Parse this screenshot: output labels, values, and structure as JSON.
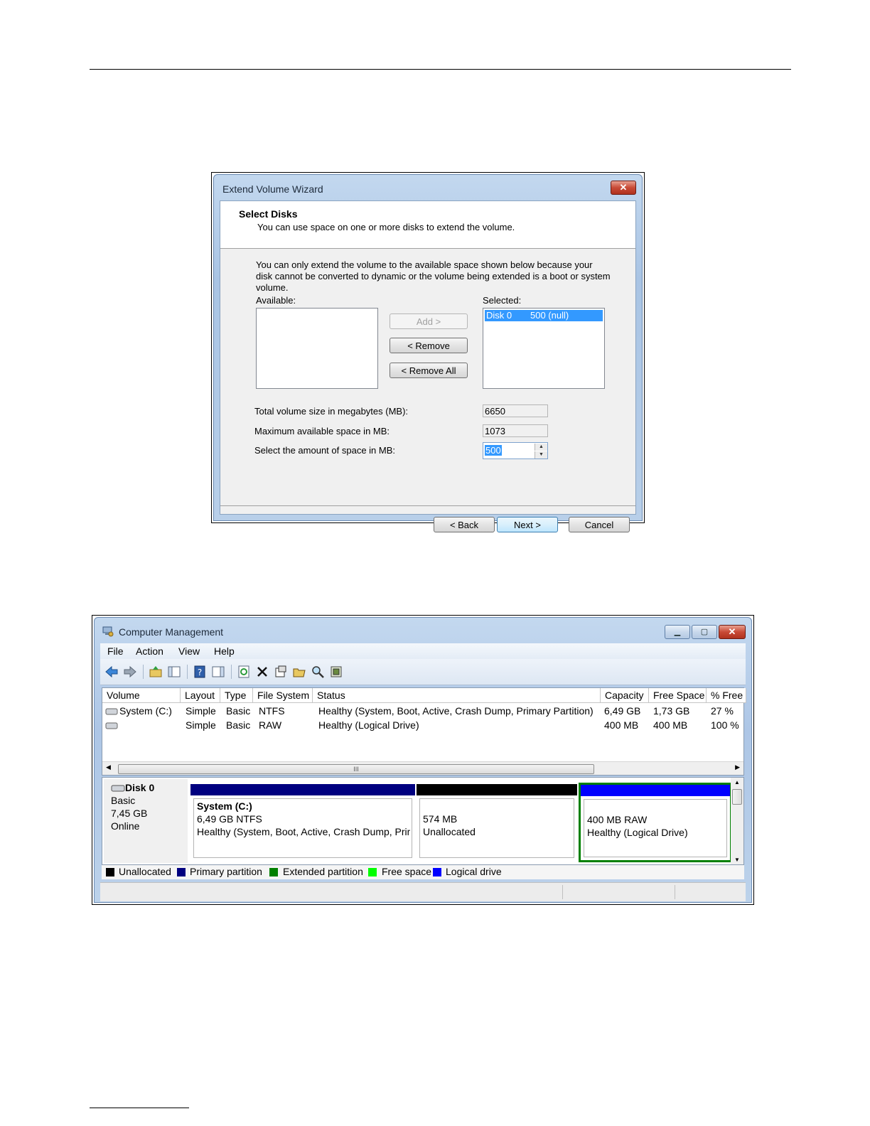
{
  "wizard": {
    "title": "Extend Volume Wizard",
    "close_glyph": "✕",
    "header_title": "Select Disks",
    "header_subtitle": "You can use space on one or more disks to extend the volume.",
    "info_text": "You can only extend the volume to the available space shown below because your disk cannot be converted to dynamic or the volume being extended is a boot or system volume.",
    "available_label": "Available:",
    "selected_label": "Selected:",
    "selected_items": [
      {
        "disk": "Disk 0",
        "size": "500 (null)"
      }
    ],
    "add_label": "Add >",
    "remove_label": "< Remove",
    "remove_all_label": "< Remove All",
    "total_size_label": "Total volume size in megabytes (MB):",
    "total_size_value": "6650",
    "max_space_label": "Maximum available space in MB:",
    "max_space_value": "1073",
    "select_space_label": "Select the amount of space in MB:",
    "select_space_value": "500",
    "back_label": "< Back",
    "next_label": "Next >",
    "cancel_label": "Cancel"
  },
  "cm": {
    "title": "Computer Management",
    "menu": [
      "File",
      "Action",
      "View",
      "Help"
    ],
    "columns": [
      "Volume",
      "Layout",
      "Type",
      "File System",
      "Status",
      "Capacity",
      "Free Space",
      "% Free"
    ],
    "rows": [
      {
        "volume": "System (C:)",
        "layout": "Simple",
        "type": "Basic",
        "fs": "NTFS",
        "status": "Healthy (System, Boot, Active, Crash Dump, Primary Partition)",
        "capacity": "6,49 GB",
        "free": "1,73 GB",
        "pct": "27 %"
      },
      {
        "volume": "",
        "layout": "Simple",
        "type": "Basic",
        "fs": "RAW",
        "status": "Healthy (Logical Drive)",
        "capacity": "400 MB",
        "free": "400 MB",
        "pct": "100 %"
      }
    ],
    "scroll_grip": "III",
    "disk": {
      "name": "Disk 0",
      "type": "Basic",
      "size": "7,45 GB",
      "state": "Online"
    },
    "partitions": [
      {
        "name": "System  (C:)",
        "line1": "6,49 GB NTFS",
        "line2": "Healthy (System, Boot, Active, Crash Dump, Primary Partition)",
        "bar_color": "#000080"
      },
      {
        "name": "",
        "line1": "574 MB",
        "line2": "Unallocated",
        "bar_color": "#000000"
      },
      {
        "name": "",
        "line1": "400 MB RAW",
        "line2": "Healthy (Logical Drive)",
        "bar_color": "#0000ff"
      }
    ],
    "legend": [
      {
        "label": "Unallocated",
        "color": "#000000"
      },
      {
        "label": "Primary partition",
        "color": "#000080"
      },
      {
        "label": "Extended partition",
        "color": "#008000"
      },
      {
        "label": "Free space",
        "color": "#00ff00"
      },
      {
        "label": "Logical drive",
        "color": "#0000ff"
      }
    ]
  }
}
